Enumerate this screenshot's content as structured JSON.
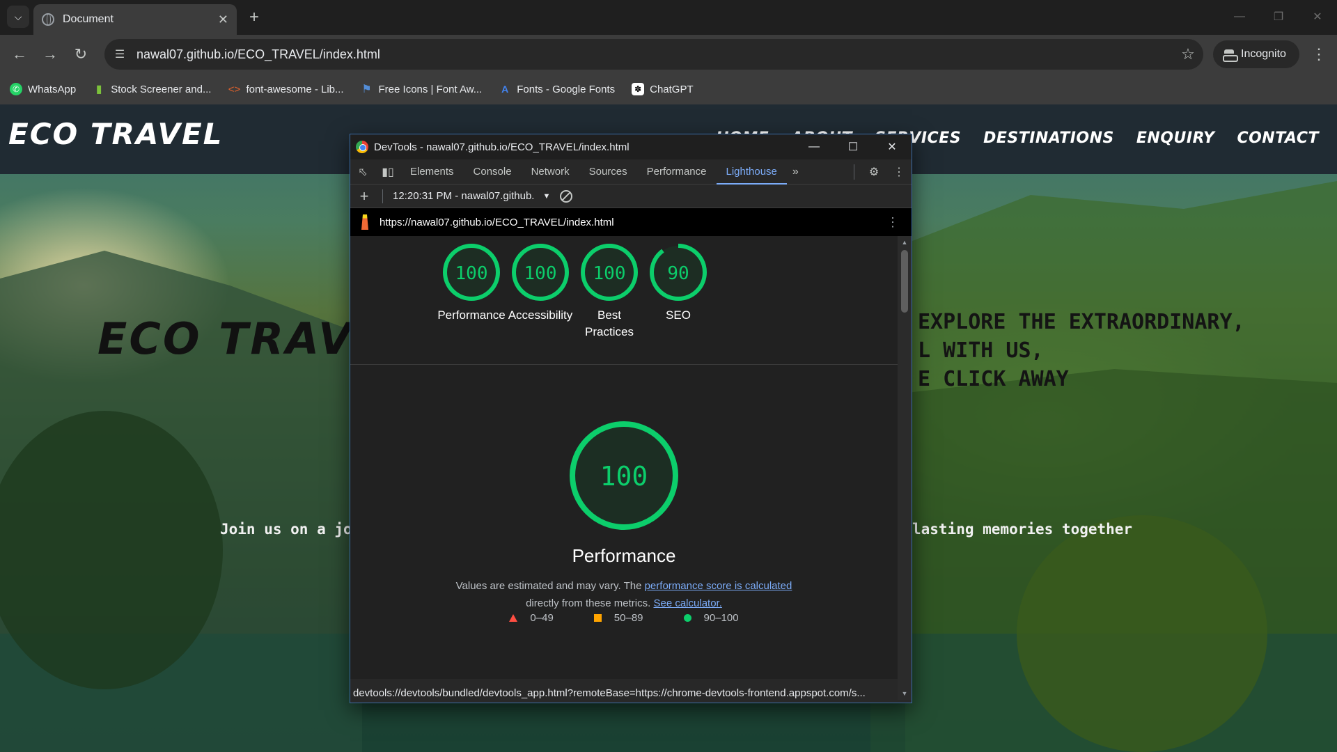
{
  "browser": {
    "tab_title": "Document",
    "url": "nawal07.github.io/ECO_TRAVEL/index.html",
    "incognito_label": "Incognito",
    "bookmarks": [
      {
        "label": "WhatsApp",
        "icon": "whatsapp-icon",
        "color": "#25d366"
      },
      {
        "label": "Stock Screener and...",
        "icon": "bar-chart-icon",
        "color": "#7cc23b"
      },
      {
        "label": "font-awesome - Lib...",
        "icon": "code-brackets-icon",
        "color": "#e8632b"
      },
      {
        "label": "Free Icons | Font Aw...",
        "icon": "flag-icon",
        "color": "#538dd7"
      },
      {
        "label": "Fonts - Google Fonts",
        "icon": "google-fonts-icon",
        "color": "#4285f4"
      },
      {
        "label": "ChatGPT",
        "icon": "chatgpt-icon",
        "color": "#ffffff"
      }
    ]
  },
  "site": {
    "logo": "ECO TRAVEL",
    "nav": [
      "HOME",
      "ABOUT",
      "SERVICES",
      "DESTINATIONS",
      "ENQUIRY",
      "CONTACT"
    ],
    "hero_title": "ECO TRAVEL",
    "hero_lines": [
      "EXPLORE THE EXTRAORDINARY,",
      "L WITH US,",
      "E CLICK AWAY"
    ],
    "hero_sub_left": "Join us on a jour",
    "hero_sub_right": "lasting memories together"
  },
  "devtools": {
    "window_title": "DevTools - nawal07.github.io/ECO_TRAVEL/index.html",
    "tabs": [
      "Elements",
      "Console",
      "Network",
      "Sources",
      "Performance",
      "Lighthouse"
    ],
    "active_tab": "Lighthouse",
    "report_selector": "12:20:31 PM - nawal07.github.",
    "report_url": "https://nawal07.github.io/ECO_TRAVEL/index.html",
    "gauges": [
      {
        "label": "Performance",
        "score": 100
      },
      {
        "label": "Accessibility",
        "score": 100
      },
      {
        "label": "Best Practices",
        "score": 100
      },
      {
        "label": "SEO",
        "score": 90
      }
    ],
    "main_gauge": {
      "score": 100,
      "title": "Performance"
    },
    "desc_prefix": "Values are estimated and may vary. The ",
    "desc_link1": "performance score is calculated",
    "desc_mid": "directly from these metrics. ",
    "desc_link2": "See calculator.",
    "legend": [
      {
        "range": "0–49",
        "color": "#ff4e42"
      },
      {
        "range": "50–89",
        "color": "#ffa400"
      },
      {
        "range": "90–100",
        "color": "#0cce6b"
      }
    ],
    "status_url": "devtools://devtools/bundled/devtools_app.html?remoteBase=https://chrome-devtools-frontend.appspot.com/s..."
  }
}
